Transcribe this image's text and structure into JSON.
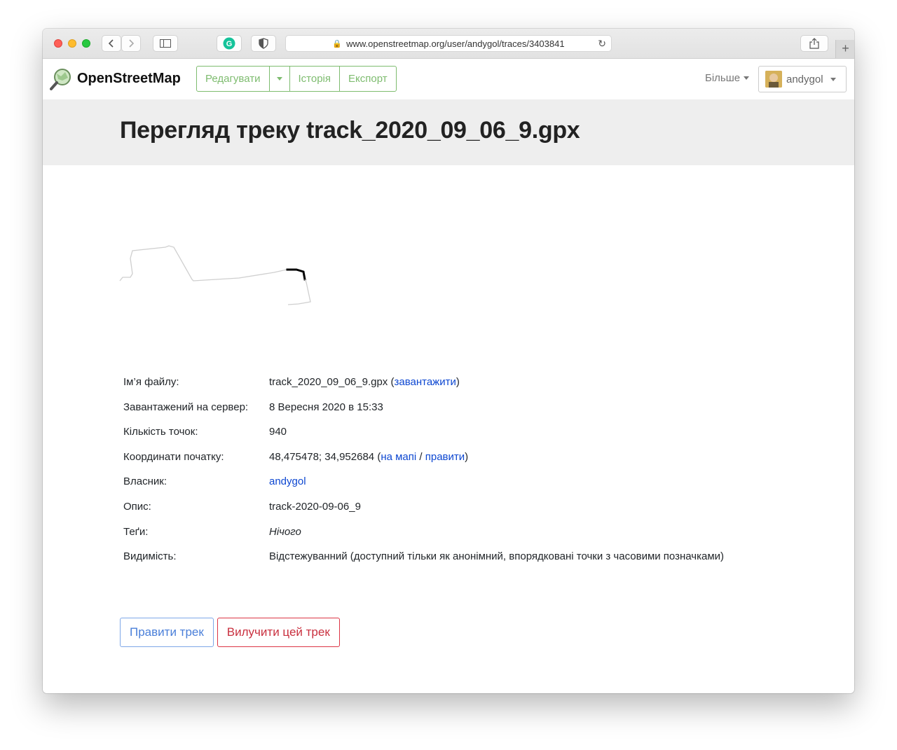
{
  "browser": {
    "url": "www.openstreetmap.org/user/andygol/traces/3403841",
    "new_tab": "+"
  },
  "osm": {
    "brand": "OpenStreetMap",
    "nav": {
      "edit": "Редагувати",
      "history": "Історія",
      "export": "Експорт"
    },
    "more": "Більше",
    "user": "andygol"
  },
  "page": {
    "title": "Перегляд треку track_2020_09_06_9.gpx"
  },
  "details": {
    "filename_label": "Ім’я файлу:",
    "filename": "track_2020_09_06_9.gpx",
    "download_link": "завантажити",
    "uploaded_label": "Завантажений на сервер:",
    "uploaded": "8 Вересня 2020 в 15:33",
    "points_label": "Кількість точок:",
    "points": "940",
    "start_label": "Координати початку:",
    "start": "48,475478; 34,952684",
    "on_map_link": "на мапі",
    "edit_link": "правити",
    "owner_label": "Власник:",
    "owner": "andygol",
    "description_label": "Опис:",
    "description": "track-2020-09-06_9",
    "tags_label": "Теґи:",
    "tags": "Нічого",
    "visibility_label": "Видимість:",
    "visibility": "Відстежуванний (доступний тільки як анонімний, впорядковані точки з часовими позначками)"
  },
  "actions": {
    "edit_trace": "Правити трек",
    "delete_trace": "Вилучити цей трек"
  },
  "colors": {
    "osm_green": "#7ebc6f",
    "link_blue": "#0d47d1",
    "danger_red": "#dc3545"
  }
}
